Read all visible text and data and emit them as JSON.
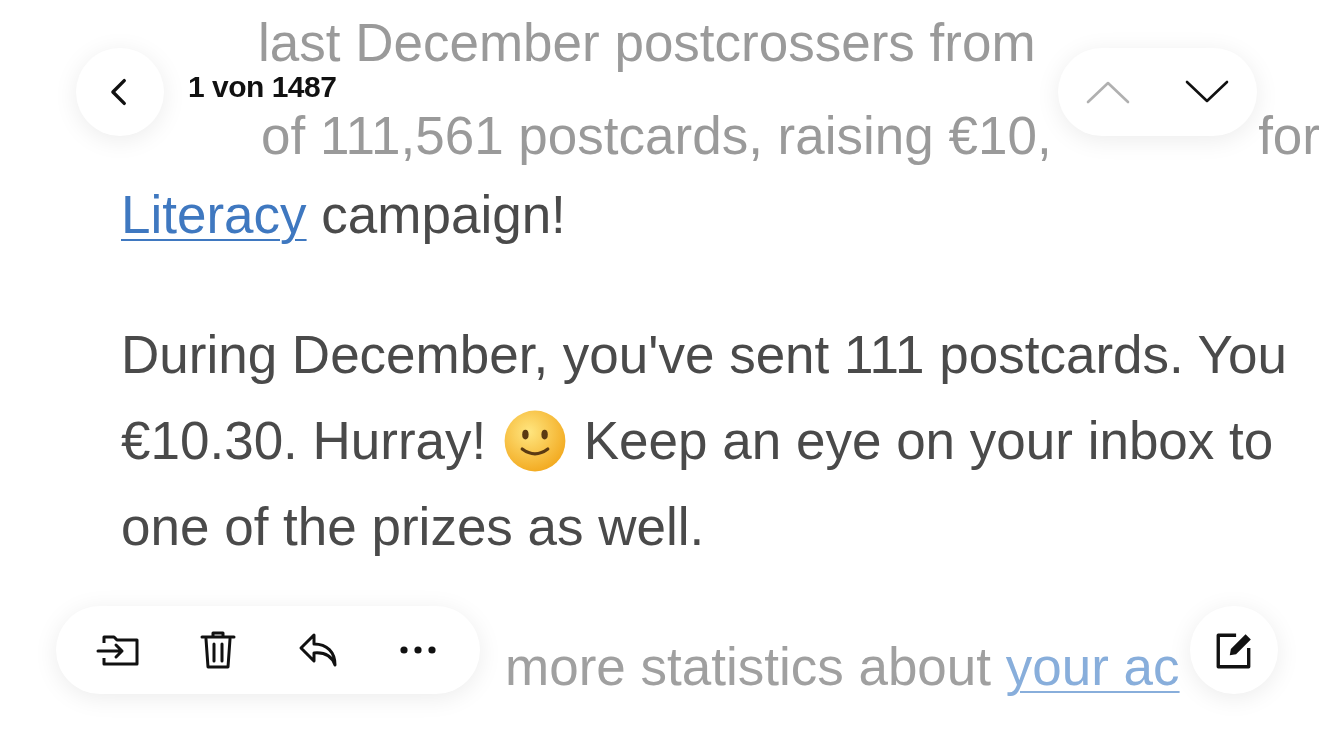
{
  "navigation": {
    "counter": "1 von 1487",
    "previous": {
      "disabled": true
    },
    "next": {
      "disabled": false
    }
  },
  "message": {
    "paragraphs": [
      {
        "lines": [
          [
            {
              "kind": "text",
              "text": "last December postcrossers from"
            }
          ],
          [
            {
              "kind": "text",
              "text": "of 111,561 postcards, raising €10,"
            },
            {
              "kind": "text",
              "text": "for"
            }
          ],
          [
            {
              "kind": "link",
              "text": "Literacy"
            },
            {
              "kind": "text",
              "text": " campaign!"
            }
          ]
        ]
      },
      {
        "lines": [
          [
            {
              "kind": "text",
              "text": "During December, you've sent 111 postcards. You"
            }
          ],
          [
            {
              "kind": "text",
              "text": "€10.30. Hurray! "
            },
            {
              "kind": "emoji"
            },
            {
              "kind": "text",
              "text": " Keep an eye on your inbox to"
            }
          ],
          [
            {
              "kind": "text",
              "text": "one of the prizes as well."
            }
          ]
        ]
      },
      {
        "lines": [
          [
            {
              "kind": "text",
              "text": "more statistics about "
            },
            {
              "kind": "link",
              "text": "your ac"
            }
          ]
        ]
      }
    ]
  },
  "toolbar": {
    "actions": [
      {
        "kind": "move"
      },
      {
        "kind": "trash"
      },
      {
        "kind": "reply"
      },
      {
        "kind": "more"
      }
    ]
  }
}
